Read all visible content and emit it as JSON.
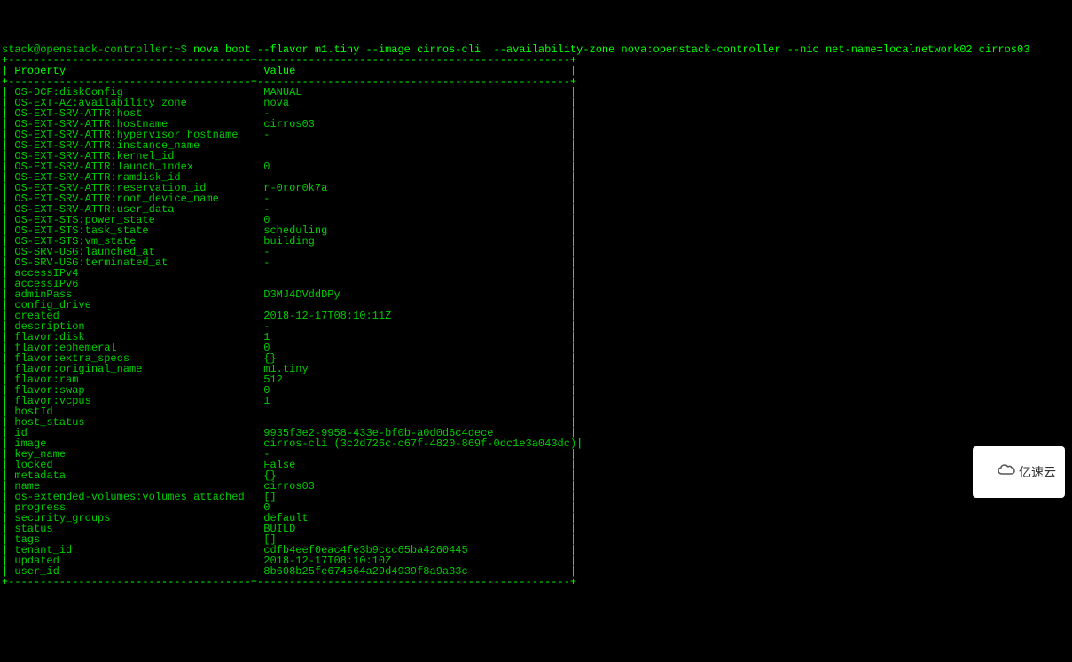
{
  "prompt": {
    "user_host": "stack@openstack-controller",
    "path": "~",
    "symbol": "$",
    "command": "nova boot --flavor m1.tiny --image cirros-cli  --availability-zone nova:openstack-controller --nic net-name=localnetwork02 cirros03"
  },
  "table": {
    "headers": [
      "Property",
      "Value"
    ],
    "rows": [
      {
        "property": "OS-DCF:diskConfig",
        "value": "MANUAL"
      },
      {
        "property": "OS-EXT-AZ:availability_zone",
        "value": "nova"
      },
      {
        "property": "OS-EXT-SRV-ATTR:host",
        "value": "-"
      },
      {
        "property": "OS-EXT-SRV-ATTR:hostname",
        "value": "cirros03"
      },
      {
        "property": "OS-EXT-SRV-ATTR:hypervisor_hostname",
        "value": "-"
      },
      {
        "property": "OS-EXT-SRV-ATTR:instance_name",
        "value": ""
      },
      {
        "property": "OS-EXT-SRV-ATTR:kernel_id",
        "value": ""
      },
      {
        "property": "OS-EXT-SRV-ATTR:launch_index",
        "value": "0"
      },
      {
        "property": "OS-EXT-SRV-ATTR:ramdisk_id",
        "value": ""
      },
      {
        "property": "OS-EXT-SRV-ATTR:reservation_id",
        "value": "r-0ror0k7a"
      },
      {
        "property": "OS-EXT-SRV-ATTR:root_device_name",
        "value": "-"
      },
      {
        "property": "OS-EXT-SRV-ATTR:user_data",
        "value": "-"
      },
      {
        "property": "OS-EXT-STS:power_state",
        "value": "0"
      },
      {
        "property": "OS-EXT-STS:task_state",
        "value": "scheduling"
      },
      {
        "property": "OS-EXT-STS:vm_state",
        "value": "building"
      },
      {
        "property": "OS-SRV-USG:launched_at",
        "value": "-"
      },
      {
        "property": "OS-SRV-USG:terminated_at",
        "value": "-"
      },
      {
        "property": "accessIPv4",
        "value": ""
      },
      {
        "property": "accessIPv6",
        "value": ""
      },
      {
        "property": "adminPass",
        "value": "D3MJ4DVddDPy"
      },
      {
        "property": "config_drive",
        "value": ""
      },
      {
        "property": "created",
        "value": "2018-12-17T08:10:11Z"
      },
      {
        "property": "description",
        "value": "-"
      },
      {
        "property": "flavor:disk",
        "value": "1"
      },
      {
        "property": "flavor:ephemeral",
        "value": "0"
      },
      {
        "property": "flavor:extra_specs",
        "value": "{}"
      },
      {
        "property": "flavor:original_name",
        "value": "m1.tiny"
      },
      {
        "property": "flavor:ram",
        "value": "512"
      },
      {
        "property": "flavor:swap",
        "value": "0"
      },
      {
        "property": "flavor:vcpus",
        "value": "1"
      },
      {
        "property": "hostId",
        "value": ""
      },
      {
        "property": "host_status",
        "value": ""
      },
      {
        "property": "id",
        "value": "9935f3e2-9958-433e-bf0b-a0d0d6c4dece"
      },
      {
        "property": "image",
        "value": "cirros-cli (3c2d726c-c67f-4820-869f-0dc1e3a043dc)"
      },
      {
        "property": "key_name",
        "value": "-"
      },
      {
        "property": "locked",
        "value": "False"
      },
      {
        "property": "metadata",
        "value": "{}"
      },
      {
        "property": "name",
        "value": "cirros03"
      },
      {
        "property": "os-extended-volumes:volumes_attached",
        "value": "[]"
      },
      {
        "property": "progress",
        "value": "0"
      },
      {
        "property": "security_groups",
        "value": "default"
      },
      {
        "property": "status",
        "value": "BUILD"
      },
      {
        "property": "tags",
        "value": "[]"
      },
      {
        "property": "tenant_id",
        "value": "cdfb4eef0eac4fe3b9ccc65ba4260445"
      },
      {
        "property": "updated",
        "value": "2018-12-17T08:10:10Z"
      },
      {
        "property": "user_id",
        "value": "8b608b25fe674564a29d4939f8a9a33c"
      }
    ],
    "col1_width": 38,
    "col2_width": 49
  },
  "watermark": {
    "text": "亿速云"
  }
}
